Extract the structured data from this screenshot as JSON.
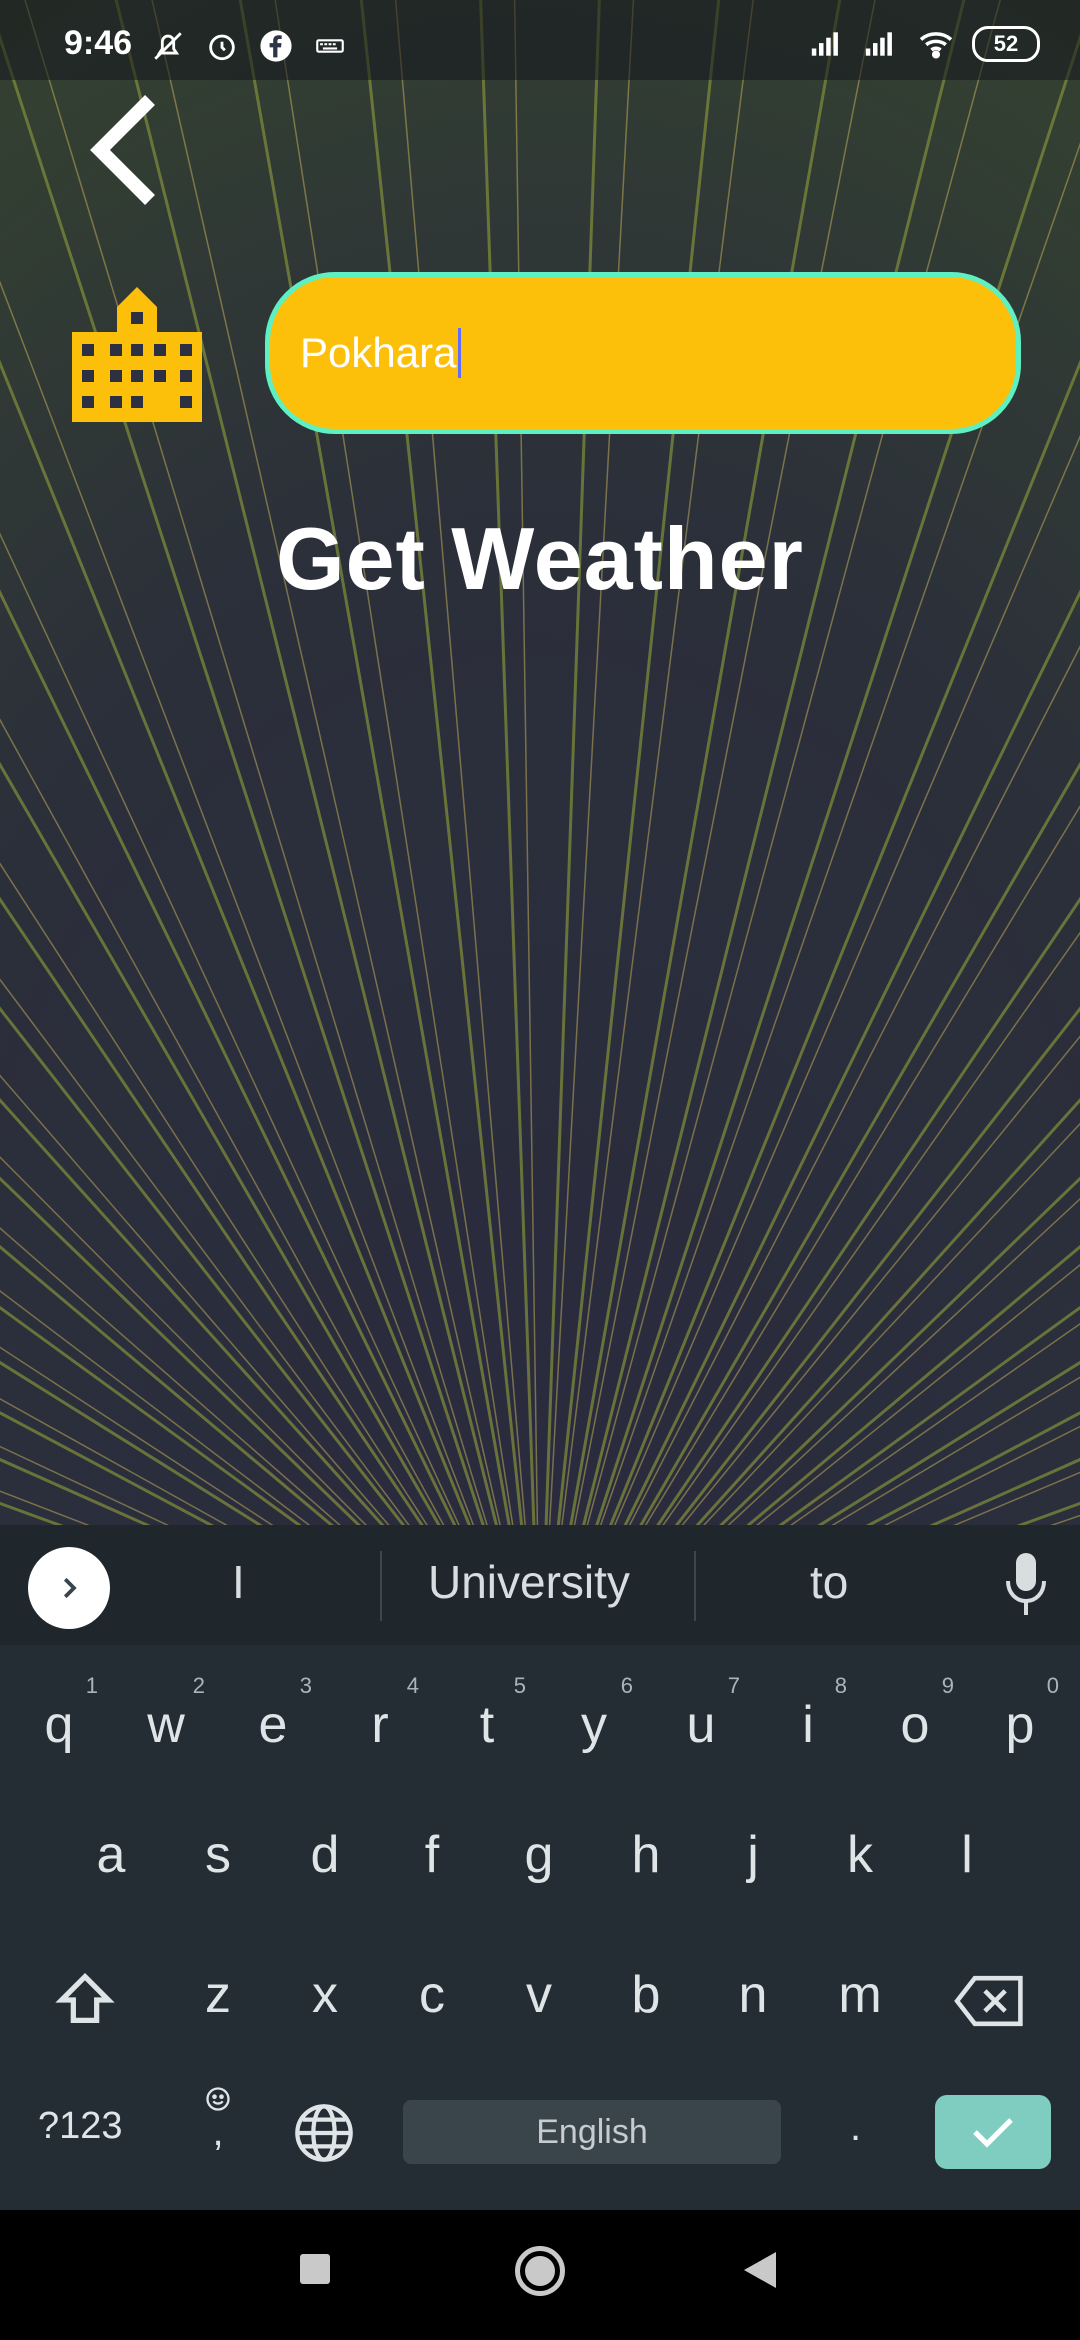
{
  "status_bar": {
    "time": "9:46",
    "battery": "52",
    "icons": [
      "mute-icon",
      "alarm-icon",
      "facebook-icon",
      "keyboard-icon",
      "signal-icon",
      "signal-icon",
      "wifi-icon",
      "battery-icon"
    ]
  },
  "app": {
    "city_input": {
      "value": "Pokhara"
    },
    "title": "Get Weather",
    "accent_color": "#fcbf0a",
    "border_color": "#5ef0c3"
  },
  "keyboard": {
    "suggestions": [
      "I",
      "University",
      "to"
    ],
    "row1": [
      {
        "k": "q",
        "n": "1"
      },
      {
        "k": "w",
        "n": "2"
      },
      {
        "k": "e",
        "n": "3"
      },
      {
        "k": "r",
        "n": "4"
      },
      {
        "k": "t",
        "n": "5"
      },
      {
        "k": "y",
        "n": "6"
      },
      {
        "k": "u",
        "n": "7"
      },
      {
        "k": "i",
        "n": "8"
      },
      {
        "k": "o",
        "n": "9"
      },
      {
        "k": "p",
        "n": "0"
      }
    ],
    "row2": [
      "a",
      "s",
      "d",
      "f",
      "g",
      "h",
      "j",
      "k",
      "l"
    ],
    "row3": [
      "z",
      "x",
      "c",
      "v",
      "b",
      "n",
      "m"
    ],
    "num_label": "?123",
    "emoji_comma": ",",
    "space_label": "English",
    "period": "."
  }
}
